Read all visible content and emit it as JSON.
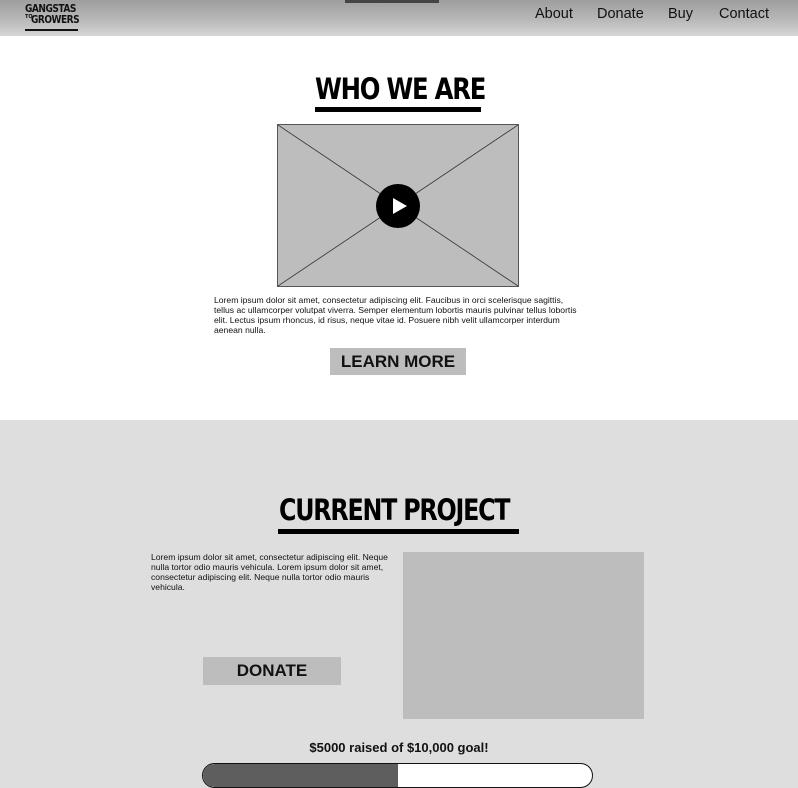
{
  "header": {
    "logo_line1": "GANGSTAS",
    "logo_to": "TO",
    "logo_line2": "GROWERS",
    "nav": [
      "About",
      "Donate",
      "Buy",
      "Contact"
    ]
  },
  "who_we_are": {
    "title": "WHO WE ARE",
    "body": "Lorem ipsum dolor sit amet, consectetur adipiscing elit. Faucibus in orci scelerisque sagittis, tellus ac ullamcorper volutpat viverra. Semper elementum lobortis mauris pulvinar tellus lobortis elit. Lectus ipsum rhoncus, id risus, neque vitae id. Posuere nibh velit ullamcorper interdum aenean nulla.",
    "button": "LEARN MORE"
  },
  "current_project": {
    "title": "CURRENT PROJECT",
    "body": "Lorem ipsum dolor sit amet, consectetur adipiscing elit. Neque nulla tortor odio mauris vehicula. Lorem ipsum dolor sit amet, consectetur adipiscing elit. Neque nulla tortor odio mauris vehicula.",
    "button": "DONATE",
    "raised_text": "$5000 raised of $10,000 goal!",
    "progress_fraction": 0.5
  },
  "colors": {
    "placeholder": "#bdbdbd",
    "section_bg": "#dedede",
    "progress_fill": "#5e5e5e"
  }
}
